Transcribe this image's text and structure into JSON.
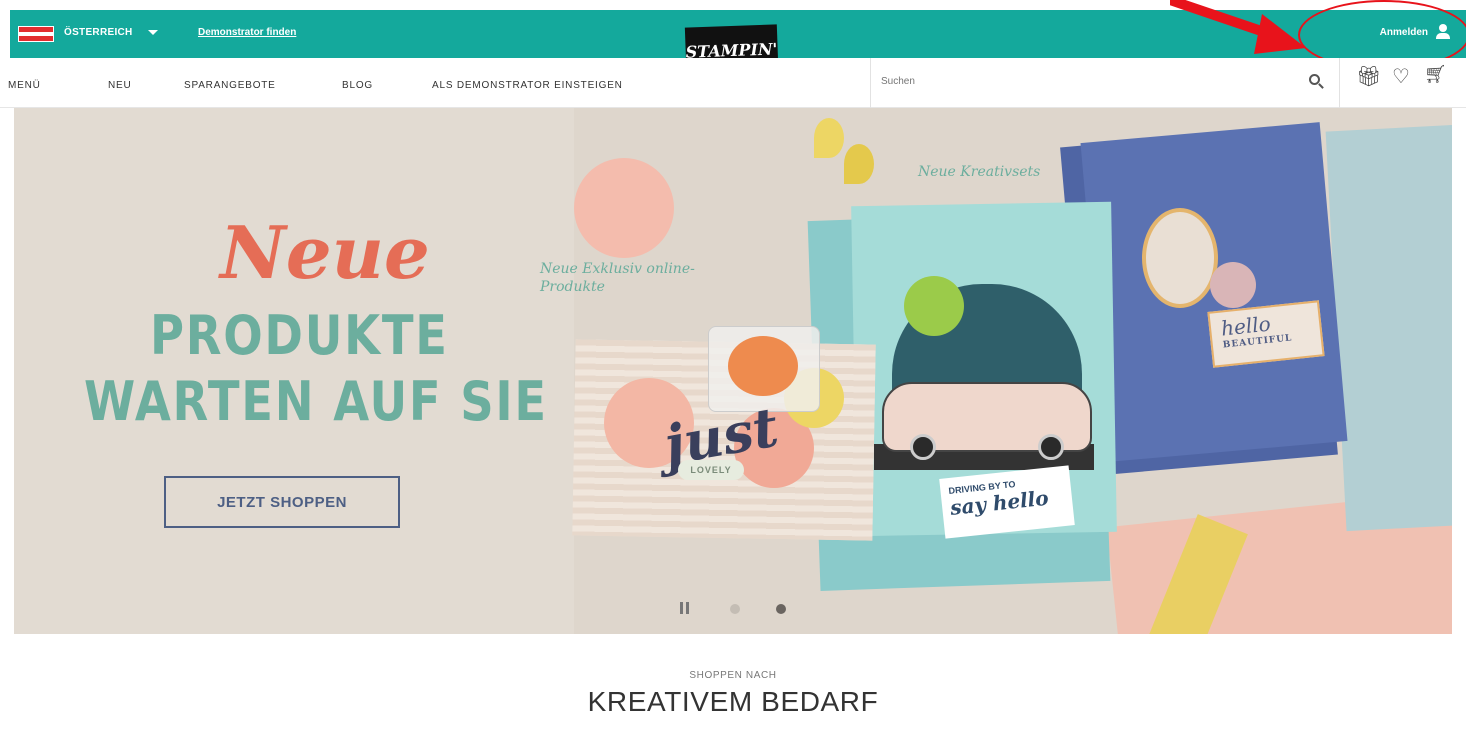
{
  "topbar": {
    "country": "ÖSTERREICH",
    "demonstrator_link": "Demonstrator finden",
    "login": "Anmelden"
  },
  "logo": {
    "text": "STAMPIN' UP!"
  },
  "nav": {
    "items": [
      {
        "label": "MENÜ"
      },
      {
        "label": "NEU"
      },
      {
        "label": "SPARANGEBOTE"
      },
      {
        "label": "BLOG"
      },
      {
        "label": "ALS DEMONSTRATOR EINSTEIGEN"
      }
    ]
  },
  "search": {
    "placeholder": "Suchen"
  },
  "icons": {
    "search": "search-icon",
    "gift": "gift-icon",
    "wishlist": "heart-icon",
    "cart": "cart-icon",
    "user": "user-icon",
    "country_dropdown": "chevron-down-icon"
  },
  "hero": {
    "title_script": "Neue",
    "line1": "PRODUKTE",
    "line2": "WARTEN AUF SIE",
    "cta": "JETZT SHOPPEN",
    "annotation_exclusive": "Neue Exklusiv online-Produkte",
    "annotation_kits": "Neue Kreativsets",
    "card_just": "just",
    "card_lovely": "LOVELY",
    "card_driving": "DRIVING BY TO",
    "card_say_hello": "say hello",
    "card_hello": "hello",
    "card_beautiful": "BEAUTIFUL"
  },
  "carousel": {
    "slides": 2,
    "active_slide": 2
  },
  "section": {
    "kicker": "SHOPPEN NACH",
    "title": "KREATIVEM BEDARF"
  },
  "colors": {
    "brand_teal": "#14a99c",
    "hero_accent_coral": "#e56d56",
    "hero_accent_green": "#6cae9e",
    "cta_navy": "#4d5f84",
    "annotation_red": "#e8131b"
  }
}
